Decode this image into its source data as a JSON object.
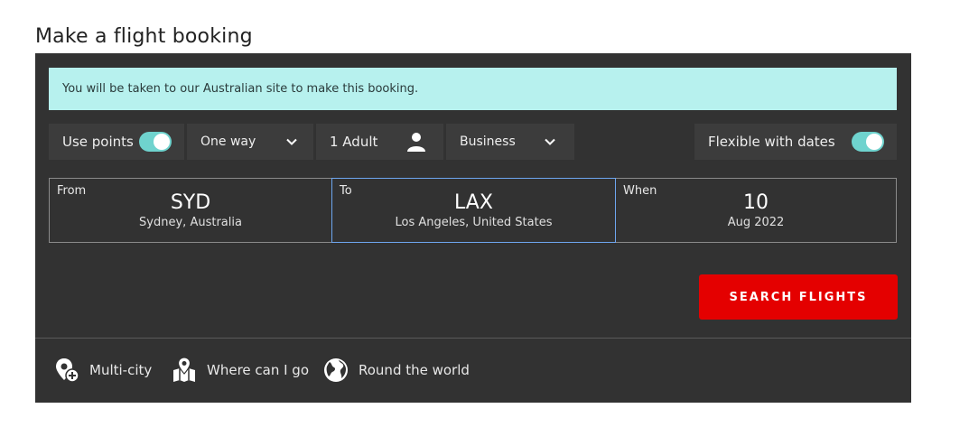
{
  "page": {
    "title": "Make a flight booking"
  },
  "notice": {
    "text": "You will be taken to our Australian site to make this booking."
  },
  "options": {
    "use_points": {
      "label": "Use points",
      "on": true
    },
    "trip_type": {
      "value": "One way",
      "icon": "chevron-down-icon"
    },
    "passengers": {
      "value": "1 Adult",
      "icon": "person-icon"
    },
    "cabin": {
      "value": "Business",
      "icon": "chevron-down-icon"
    },
    "flexible_dates": {
      "label": "Flexible with dates",
      "on": true
    }
  },
  "route": {
    "from": {
      "label": "From",
      "code": "SYD",
      "city": "Sydney, Australia"
    },
    "to": {
      "label": "To",
      "code": "LAX",
      "city": "Los Angeles, United States"
    },
    "when": {
      "label": "When",
      "day": "10",
      "month_year": "Aug 2022"
    }
  },
  "search": {
    "label": "SEARCH FLIGHTS"
  },
  "links": {
    "multi_city": "Multi-city",
    "where_can_i_go": "Where can I go",
    "round_the_world": "Round the world"
  },
  "colors": {
    "panel": "#323232",
    "notice_bg": "#b7f1ee",
    "toggle": "#6fd3ce",
    "search_button": "#e40000",
    "focus_border": "#6ea6f0"
  }
}
